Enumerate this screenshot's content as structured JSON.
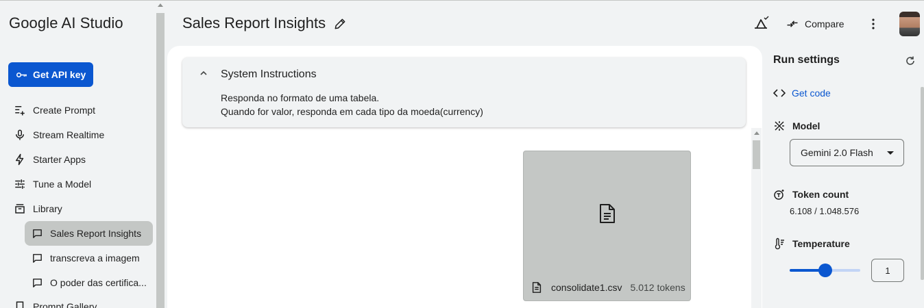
{
  "app": {
    "brand": "Google AI Studio"
  },
  "sidebar": {
    "api_button": "Get API key",
    "items": [
      {
        "label": "Create Prompt",
        "icon": "create-prompt-icon"
      },
      {
        "label": "Stream Realtime",
        "icon": "microphone-icon"
      },
      {
        "label": "Starter Apps",
        "icon": "bolt-icon"
      },
      {
        "label": "Tune a Model",
        "icon": "tune-icon"
      },
      {
        "label": "Library",
        "icon": "library-icon"
      }
    ],
    "library_items": [
      {
        "label": "Sales Report Insights",
        "active": true
      },
      {
        "label": "transcreva a imagem",
        "active": false
      },
      {
        "label": "O poder das certifica...",
        "active": false
      }
    ],
    "gallery": {
      "label": "Prompt Gallery",
      "icon": "gallery-icon"
    }
  },
  "header": {
    "title": "Sales Report Insights",
    "compare_label": "Compare"
  },
  "system_instructions": {
    "heading": "System Instructions",
    "line1": "Responda no formato de uma tabela.",
    "line2": "Quando for valor, responda em cada tipo da moeda(currency)"
  },
  "attachment": {
    "file_name": "consolidate1.csv",
    "tokens": "5.012 tokens"
  },
  "run_settings": {
    "title": "Run settings",
    "get_code": "Get code",
    "model_label": "Model",
    "model_value": "Gemini 2.0 Flash",
    "token_label": "Token count",
    "token_value": "6.108 / 1.048.576",
    "temperature_label": "Temperature",
    "temperature_value": "1",
    "temperature_fraction": 0.5
  },
  "colors": {
    "accent": "#0b57d0",
    "background": "#f1f3f4",
    "canvas": "#ffffff"
  }
}
